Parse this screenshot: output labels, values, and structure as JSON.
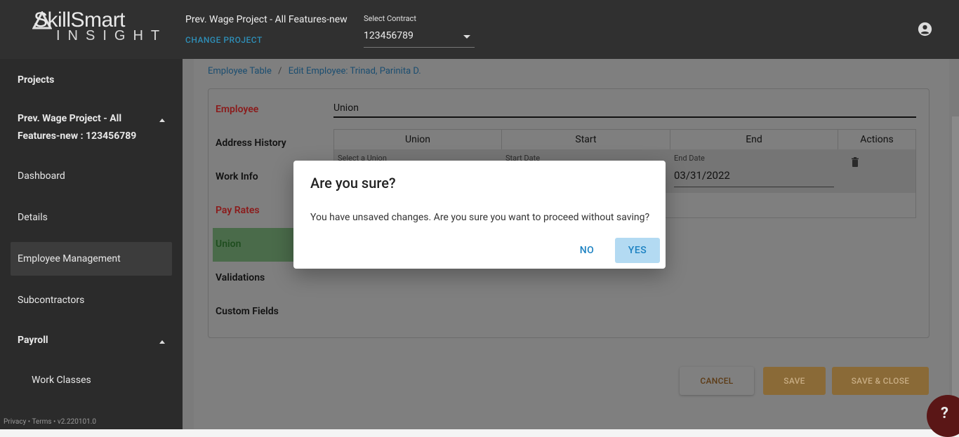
{
  "header": {
    "logo_main": "SkillSmart",
    "logo_sub": "INSIGHT",
    "project_name": "Prev. Wage Project - All Features-new",
    "change_project": "CHANGE PROJECT",
    "contract_label": "Select Contract",
    "contract_value": "123456789"
  },
  "sidebar": {
    "projects": "Projects",
    "project_line1": "Prev. Wage Project - All",
    "project_line2": "Features-new : 123456789",
    "dashboard": "Dashboard",
    "details": "Details",
    "employee_management": "Employee Management",
    "subcontractors": "Subcontractors",
    "payroll": "Payroll",
    "work_classes": "Work Classes",
    "footer": "Privacy • Terms • v2.220101.0"
  },
  "breadcrumb": {
    "parent": "Employee Table",
    "separator": "/",
    "current": "Edit Employee: Trinad, Parinita D."
  },
  "tabs": {
    "employee": "Employee",
    "address_history": "Address History",
    "work_info": "Work Info",
    "pay_rates": "Pay Rates",
    "union": "Union",
    "validations": "Validations",
    "custom_fields": "Custom Fields"
  },
  "union_section": {
    "title": "Union",
    "columns": [
      "Union",
      "Start",
      "End",
      "Actions"
    ],
    "row": {
      "union_label": "Select a Union",
      "start_label": "Start Date",
      "end_label": "End Date",
      "end_value": "03/31/2022"
    }
  },
  "actions": {
    "cancel": "CANCEL",
    "save": "SAVE",
    "save_close": "SAVE & CLOSE",
    "help": "?"
  },
  "dialog": {
    "title": "Are you sure?",
    "message": "You have unsaved changes. Are you sure you want to proceed without saving?",
    "no": "NO",
    "yes": "YES"
  }
}
